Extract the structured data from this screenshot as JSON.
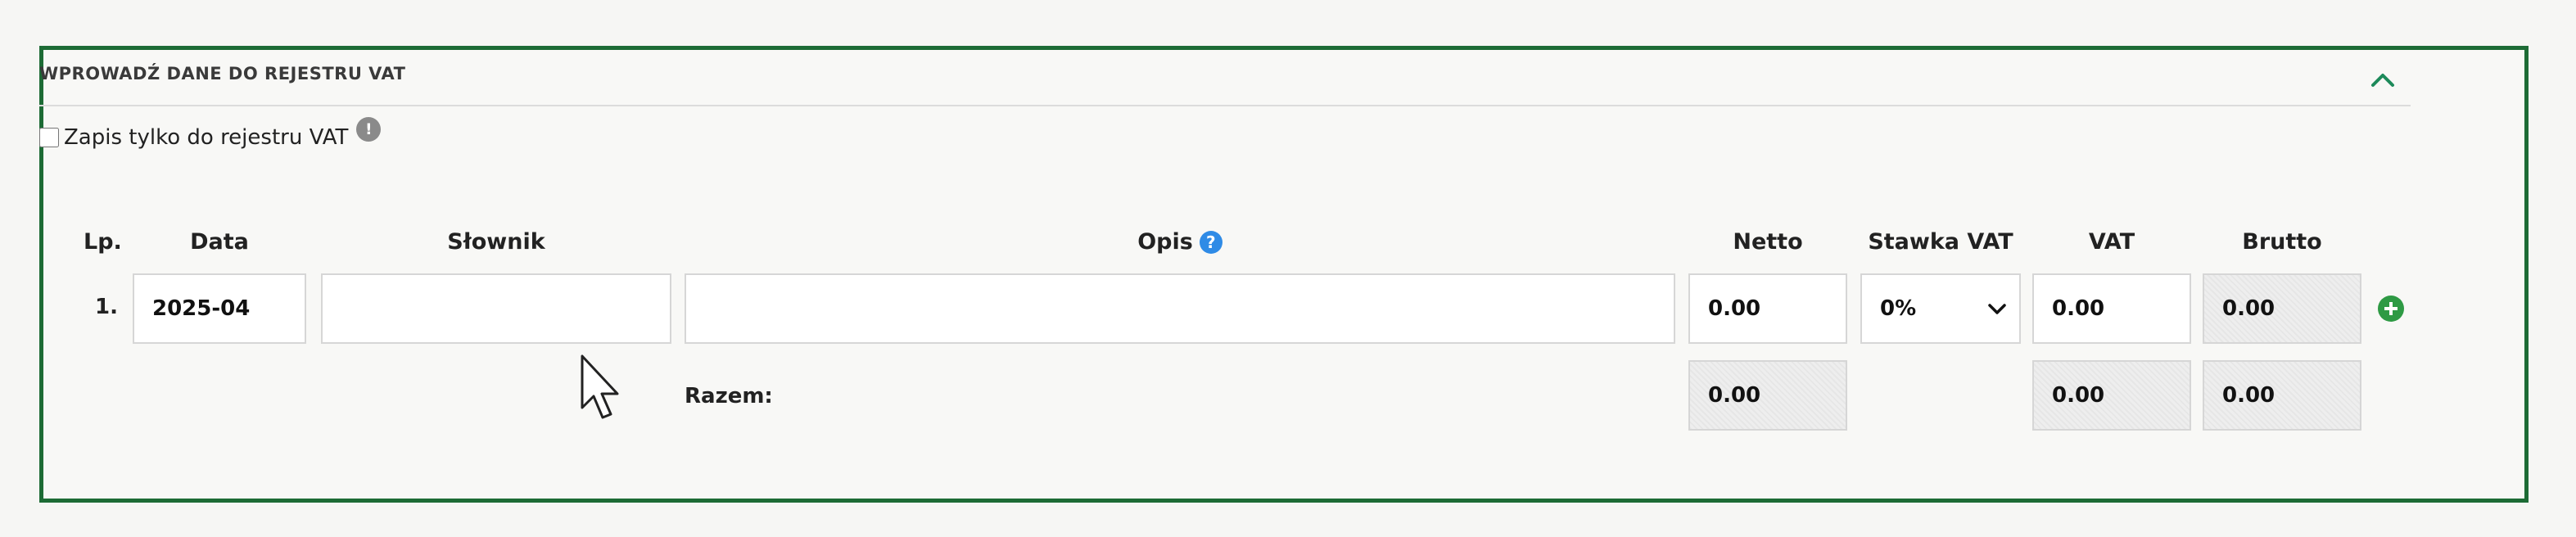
{
  "section": {
    "title": "WPROWADŹ DANE DO REJESTRU VAT",
    "vat_only_label": "Zapis tylko do rejestru VAT",
    "vat_only_checked": false
  },
  "columns": {
    "lp": "Lp.",
    "data": "Data",
    "slownik": "Słownik",
    "opis": "Opis",
    "netto": "Netto",
    "stawka": "Stawka VAT",
    "vat": "VAT",
    "brutto": "Brutto"
  },
  "icons": {
    "collapse": "chevron-up-icon",
    "info": "info-icon",
    "help": "help-icon",
    "add": "plus-circle-icon"
  },
  "colors": {
    "border": "#1d6b35",
    "help": "#2f8be6",
    "add": "#2e9a44"
  },
  "rows": [
    {
      "lp": "1.",
      "data": "2025-04",
      "slownik": "",
      "opis": "",
      "netto": "0.00",
      "stawka": "0%",
      "vat": "0.00",
      "brutto": "0.00"
    }
  ],
  "totals": {
    "label": "Razem:",
    "netto": "0.00",
    "vat": "0.00",
    "brutto": "0.00"
  }
}
